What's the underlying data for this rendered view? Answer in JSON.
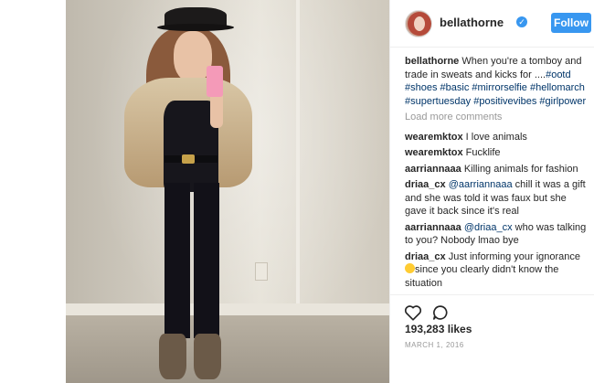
{
  "post": {
    "username": "bellathorne",
    "verified_mark": "✓",
    "follow_label": "Follow",
    "caption": {
      "user": "bellathorne",
      "text": "When you're a tomboy and trade in sweats and kicks for ....",
      "hashtags": [
        "#ootd",
        "#shoes",
        "#basic",
        "#mirrorselfie",
        "#hellomarch",
        "#supertuesday",
        "#positivevibes",
        "#girlpower"
      ]
    },
    "load_more_label": "Load more comments",
    "comments": [
      {
        "user": "wearemktox",
        "text": "I love animals"
      },
      {
        "user": "wearemktox",
        "text": "Fucklife"
      },
      {
        "user": "aarriannaaa",
        "text": "Killing animals for fashion"
      },
      {
        "user": "driaa_cx",
        "mention": "@aarriannaaa",
        "text": "chill it was a gift and she was told it was faux but she gave it back since it's real"
      },
      {
        "user": "aarriannaaa",
        "mention": "@driaa_cx",
        "text": "who was talking to you? Nobody lmao bye"
      },
      {
        "user": "driaa_cx",
        "text_before": "Just informing your ignorance",
        "text_after": "since you clearly didn't know the situation"
      }
    ],
    "likes": "193,283 likes",
    "date": "MARCH 1, 2016"
  },
  "icons": {
    "like": "heart-icon",
    "comment": "comment-bubble-icon",
    "verified": "verified-badge-icon",
    "emoji": "smile-emoji-icon"
  },
  "colors": {
    "accent": "#3897f0",
    "hashtag": "#003569",
    "muted": "#999999",
    "text": "#262626"
  }
}
